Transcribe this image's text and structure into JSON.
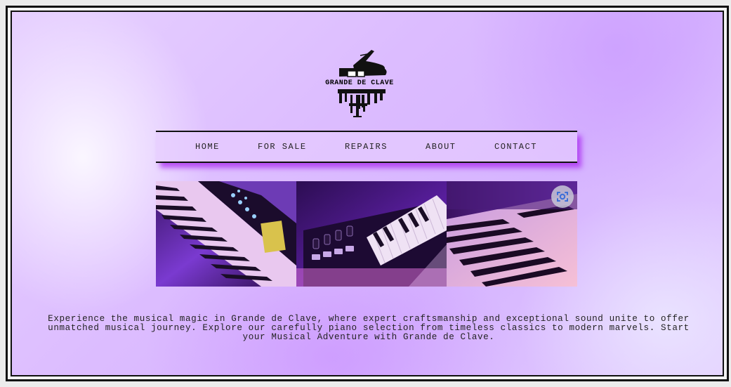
{
  "brand": {
    "logo_text": "GRANDE DE CLAVE",
    "logo_icon": "grand-piano-icon"
  },
  "nav": {
    "items": [
      {
        "label": "HOME"
      },
      {
        "label": "FOR SALE"
      },
      {
        "label": "REPAIRS"
      },
      {
        "label": "ABOUT"
      },
      {
        "label": "CONTACT"
      }
    ]
  },
  "gallery": {
    "images": [
      {
        "subject": "synthesizer keyboard under purple light"
      },
      {
        "subject": "MIDI keyboard controller with pads"
      },
      {
        "subject": "piano keys in pink light"
      }
    ],
    "lens_icon": "visual-search-icon"
  },
  "main": {
    "description": "Experience the musical magic in Grande de Clave, where expert craftsmanship and exceptional sound unite to offer unmatched musical journey. Explore our carefully piano selection from timeless classics to modern marvels. Start your Musical Adventure with Grande de Clave."
  },
  "colors": {
    "accent": "#b13cf2",
    "text": "#222222",
    "background": "#dcbcff"
  }
}
